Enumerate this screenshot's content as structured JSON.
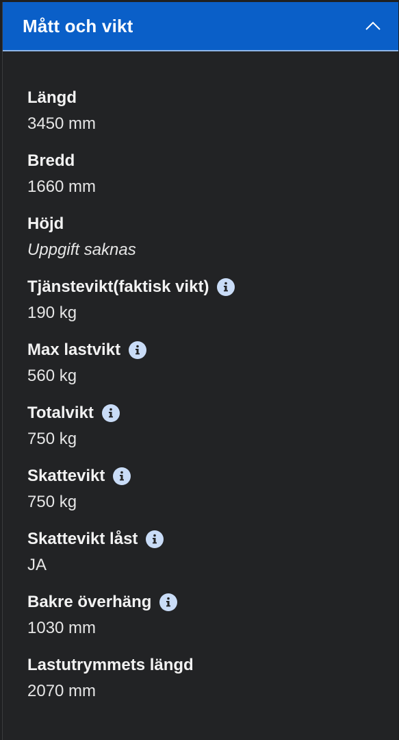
{
  "section": {
    "title": "Mått och vikt",
    "toggle_icon": "chevron-up-icon"
  },
  "items": [
    {
      "label": "Längd",
      "value": "3450 mm",
      "has_info": false
    },
    {
      "label": "Bredd",
      "value": "1660 mm",
      "has_info": false
    },
    {
      "label": "Höjd",
      "value": "Uppgift saknas",
      "has_info": false,
      "missing": true
    },
    {
      "label": "Tjänstevikt(faktisk vikt)",
      "value": "190 kg",
      "has_info": true
    },
    {
      "label": "Max lastvikt",
      "value": "560 kg",
      "has_info": true
    },
    {
      "label": "Totalvikt",
      "value": "750 kg",
      "has_info": true
    },
    {
      "label": "Skattevikt",
      "value": "750 kg",
      "has_info": true
    },
    {
      "label": "Skattevikt låst",
      "value": "JA",
      "has_info": true
    },
    {
      "label": "Bakre överhäng",
      "value": "1030 mm",
      "has_info": true
    },
    {
      "label": "Lastutrymmets längd",
      "value": "2070 mm",
      "has_info": false
    }
  ],
  "colors": {
    "header_bg": "#0a5fc8",
    "panel_bg": "#222325",
    "info_badge": "#c9dcf7"
  }
}
